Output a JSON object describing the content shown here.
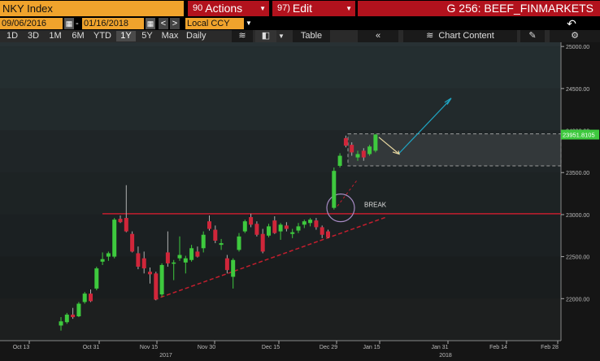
{
  "toolbar": {
    "ticker": "NKY Index",
    "actions_num": "90",
    "actions_label": "Actions",
    "edit_num": "97)",
    "edit_label": "Edit",
    "page_title": "G 256: BEEF_FINMARKETS"
  },
  "dates": {
    "start": "09/06/2016",
    "end": "01/16/2018",
    "currency": "Local CCY"
  },
  "periods": [
    "1D",
    "3D",
    "1M",
    "6M",
    "YTD",
    "1Y",
    "5Y",
    "Max"
  ],
  "active_period": "1Y",
  "frequency": "Daily",
  "table_label": "Table",
  "chart_content_label": "Chart Content",
  "chart_data": {
    "type": "candlestick",
    "ylim": [
      21500,
      25050
    ],
    "y_ticks": [
      22000,
      22500,
      23000,
      23500,
      24000,
      24500,
      25000
    ],
    "y_tick_labels": [
      "22000.00",
      "22500.00",
      "23000.00",
      "23500.00",
      "24000.00",
      "24500.00",
      "25000.00"
    ],
    "x_tick_labels": [
      "Oct 13",
      "Oct 31",
      "Nov 15",
      "Nov 30",
      "Dec 15",
      "Dec 29",
      "Jan 15",
      "Jan 31",
      "Feb 14",
      "Feb 28"
    ],
    "x_year_labels": [
      "2017",
      "2018"
    ],
    "last_price_label": "23951.8105",
    "annotation_break": "BREAK",
    "colors": {
      "up": "#3ec93e",
      "down": "#d0263a",
      "background": "#1e1e1e",
      "line": "#c41e2e",
      "arrow_up": "#1fa6c4",
      "arrow_down": "#e6d6a0"
    },
    "candles": [
      {
        "o": 21680,
        "h": 21780,
        "l": 21620,
        "c": 21730
      },
      {
        "o": 21720,
        "h": 21830,
        "l": 21700,
        "c": 21810
      },
      {
        "o": 21810,
        "h": 21890,
        "l": 21760,
        "c": 21780
      },
      {
        "o": 21790,
        "h": 21960,
        "l": 21780,
        "c": 21940
      },
      {
        "o": 21960,
        "h": 22080,
        "l": 21940,
        "c": 22060
      },
      {
        "o": 22060,
        "h": 22110,
        "l": 21960,
        "c": 21970
      },
      {
        "o": 22120,
        "h": 22380,
        "l": 22100,
        "c": 22360
      },
      {
        "o": 22440,
        "h": 22550,
        "l": 22400,
        "c": 22470
      },
      {
        "o": 22500,
        "h": 22560,
        "l": 22450,
        "c": 22540
      },
      {
        "o": 22500,
        "h": 22960,
        "l": 22480,
        "c": 22940
      },
      {
        "o": 22950,
        "h": 22990,
        "l": 22900,
        "c": 22910
      },
      {
        "o": 22960,
        "h": 23350,
        "l": 22790,
        "c": 22800
      },
      {
        "o": 22770,
        "h": 22800,
        "l": 22550,
        "c": 22560
      },
      {
        "o": 22540,
        "h": 22620,
        "l": 22350,
        "c": 22380
      },
      {
        "o": 22480,
        "h": 22560,
        "l": 22300,
        "c": 22360
      },
      {
        "o": 22320,
        "h": 22370,
        "l": 22180,
        "c": 22290
      },
      {
        "o": 22300,
        "h": 22320,
        "l": 21980,
        "c": 21990
      },
      {
        "o": 22050,
        "h": 22420,
        "l": 22020,
        "c": 22400
      },
      {
        "o": 22550,
        "h": 22800,
        "l": 22380,
        "c": 22420
      },
      {
        "o": 22420,
        "h": 22460,
        "l": 22220,
        "c": 22430
      },
      {
        "o": 22480,
        "h": 22740,
        "l": 22450,
        "c": 22520
      },
      {
        "o": 22430,
        "h": 22510,
        "l": 22300,
        "c": 22480
      },
      {
        "o": 22460,
        "h": 22640,
        "l": 22440,
        "c": 22600
      },
      {
        "o": 22560,
        "h": 22620,
        "l": 22490,
        "c": 22500
      },
      {
        "o": 22600,
        "h": 22800,
        "l": 22550,
        "c": 22760
      },
      {
        "o": 22920,
        "h": 22990,
        "l": 22810,
        "c": 22830
      },
      {
        "o": 22820,
        "h": 22870,
        "l": 22660,
        "c": 22690
      },
      {
        "o": 22640,
        "h": 22710,
        "l": 22580,
        "c": 22660
      },
      {
        "o": 22480,
        "h": 22520,
        "l": 22300,
        "c": 22340
      },
      {
        "o": 22260,
        "h": 22480,
        "l": 22120,
        "c": 22460
      },
      {
        "o": 22580,
        "h": 22780,
        "l": 22560,
        "c": 22740
      },
      {
        "o": 22800,
        "h": 22940,
        "l": 22780,
        "c": 22920
      },
      {
        "o": 22970,
        "h": 23010,
        "l": 22850,
        "c": 22880
      },
      {
        "o": 22890,
        "h": 22920,
        "l": 22740,
        "c": 22760
      },
      {
        "o": 22770,
        "h": 22830,
        "l": 22540,
        "c": 22560
      },
      {
        "o": 22750,
        "h": 22890,
        "l": 22730,
        "c": 22860
      },
      {
        "o": 22930,
        "h": 22980,
        "l": 22770,
        "c": 22780
      },
      {
        "o": 22800,
        "h": 22900,
        "l": 22700,
        "c": 22880
      },
      {
        "o": 22870,
        "h": 22910,
        "l": 22800,
        "c": 22830
      },
      {
        "o": 22770,
        "h": 22830,
        "l": 22720,
        "c": 22790
      },
      {
        "o": 22810,
        "h": 22900,
        "l": 22780,
        "c": 22860
      },
      {
        "o": 22880,
        "h": 22940,
        "l": 22840,
        "c": 22920
      },
      {
        "o": 22900,
        "h": 22960,
        "l": 22860,
        "c": 22940
      },
      {
        "o": 22930,
        "h": 22960,
        "l": 22820,
        "c": 22850
      },
      {
        "o": 22850,
        "h": 22870,
        "l": 22720,
        "c": 22760
      },
      {
        "o": 22800,
        "h": 22820,
        "l": 22720,
        "c": 22730
      },
      {
        "o": 23080,
        "h": 23560,
        "l": 23060,
        "c": 23520
      },
      {
        "o": 23580,
        "h": 23730,
        "l": 23560,
        "c": 23700
      },
      {
        "o": 23910,
        "h": 23940,
        "l": 23800,
        "c": 23820
      },
      {
        "o": 23830,
        "h": 23860,
        "l": 23700,
        "c": 23740
      },
      {
        "o": 23680,
        "h": 23760,
        "l": 23640,
        "c": 23720
      },
      {
        "o": 23760,
        "h": 23790,
        "l": 23640,
        "c": 23680
      },
      {
        "o": 23720,
        "h": 23830,
        "l": 23700,
        "c": 23810
      },
      {
        "o": 23760,
        "h": 23960,
        "l": 23740,
        "c": 23951.8105
      }
    ]
  }
}
